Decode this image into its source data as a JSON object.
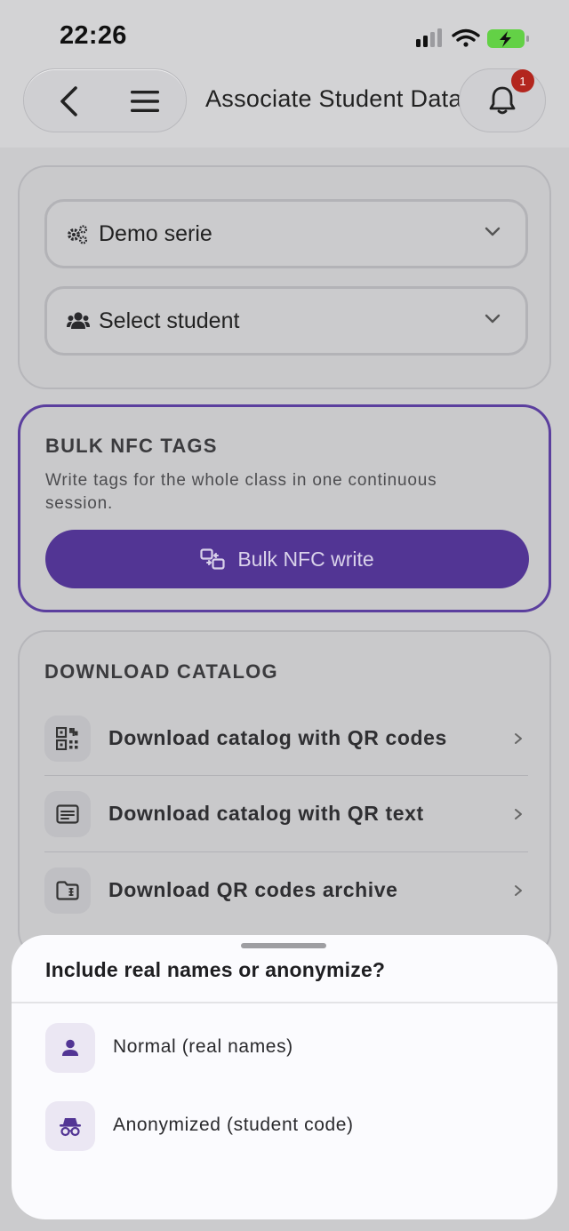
{
  "status": {
    "time": "22:26"
  },
  "header": {
    "title": "Associate Student Data",
    "notification_count": "1"
  },
  "selectors": {
    "series": {
      "value": "Demo serie"
    },
    "student": {
      "value": "Select student"
    }
  },
  "bulk": {
    "title": "BULK NFC TAGS",
    "description": "Write tags for the whole class in one continuous session.",
    "button_label": "Bulk NFC write"
  },
  "catalog": {
    "title": "DOWNLOAD CATALOG",
    "items": [
      {
        "label": "Download catalog with QR codes",
        "icon": "qr-code-icon"
      },
      {
        "label": "Download catalog with QR text",
        "icon": "text-document-icon"
      },
      {
        "label": "Download QR codes archive",
        "icon": "archive-folder-icon"
      }
    ]
  },
  "sheet": {
    "title": "Include real names or anonymize?",
    "options": [
      {
        "label": "Normal (real names)",
        "icon": "person-icon"
      },
      {
        "label": "Anonymized (student code)",
        "icon": "incognito-icon"
      }
    ]
  },
  "colors": {
    "accent": "#523594",
    "badge": "#b3261e"
  }
}
